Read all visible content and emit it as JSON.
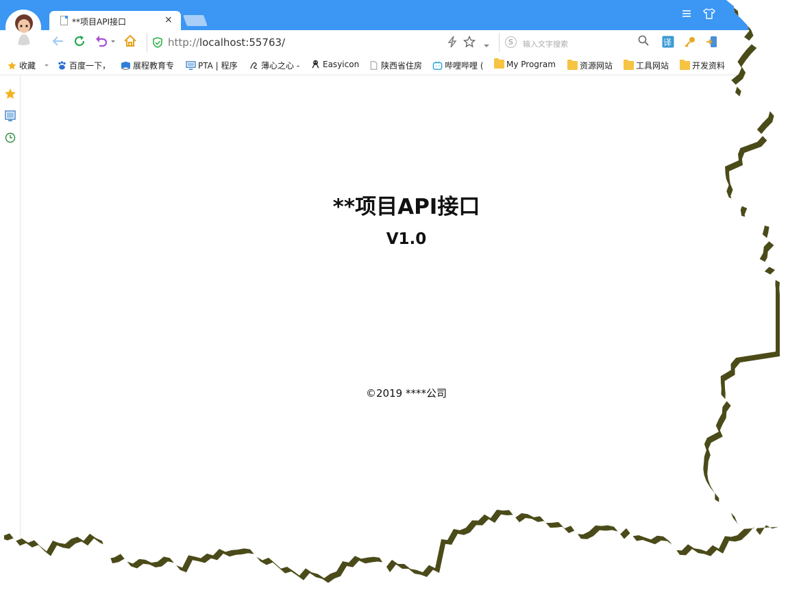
{
  "browser": {
    "tab": {
      "title": "**项目API接口",
      "close": "×"
    },
    "address": {
      "protocol": "http://",
      "host": "localhost:55763/"
    },
    "search": {
      "placeholder": "输入文字搜索"
    },
    "icons": {
      "menu": "menu-icon",
      "skin": "shirt-icon",
      "back": "back-arrow-icon",
      "refresh": "refresh-icon",
      "undo": "undo-icon",
      "home": "home-icon",
      "secure": "shield-icon",
      "lightning": "lightning-icon",
      "star": "star-icon",
      "translate": "translate-icon",
      "key": "key-icon",
      "extension": "extension-icon"
    },
    "translate_label": "译",
    "accent_color": "#3b96f4"
  },
  "bookmarks": [
    {
      "label": "收藏",
      "icon": "star-icon"
    },
    {
      "label": "百度一下，",
      "icon": "baidu-paw-icon"
    },
    {
      "label": "展程教育专",
      "icon": "book-icon"
    },
    {
      "label": "PTA | 程序",
      "icon": "monitor-icon"
    },
    {
      "label": "薄心之心 -",
      "icon": "logo-icon"
    },
    {
      "label": "Easyicon",
      "icon": "easyicon-icon"
    },
    {
      "label": "陕西省住房",
      "icon": "page-icon"
    },
    {
      "label": "哔哩哔哩 (",
      "icon": "bilibili-icon"
    },
    {
      "label": "My Program",
      "icon": "folder-icon"
    },
    {
      "label": "资源网站",
      "icon": "folder-icon"
    },
    {
      "label": "工具网站",
      "icon": "folder-icon"
    },
    {
      "label": "开发资料",
      "icon": "folder-icon"
    }
  ],
  "sidebar": [
    {
      "icon": "star-icon"
    },
    {
      "icon": "monitor-icon"
    },
    {
      "icon": "clock-icon"
    }
  ],
  "page": {
    "title": "**项目API接口",
    "version": "V1.0",
    "footer": "©2019 ****公司"
  }
}
